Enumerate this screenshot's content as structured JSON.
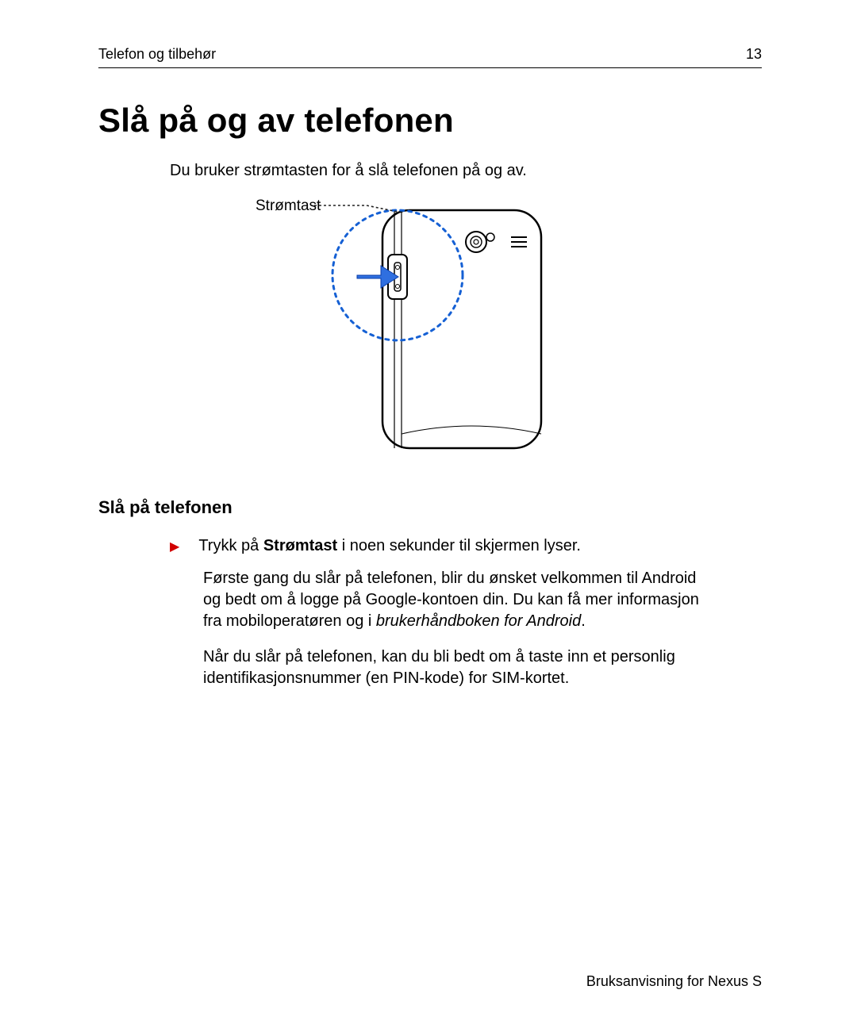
{
  "header": {
    "section": "Telefon og tilbehør",
    "page_number": "13"
  },
  "title": "Slå på og av telefonen",
  "intro": "Du bruker strømtasten for å slå telefonen på og av.",
  "figure": {
    "callout_label": "Strømtast"
  },
  "subheading": "Slå på telefonen",
  "bullet": {
    "pre": "Trykk på ",
    "bold": "Strømtast",
    "post": " i noen sekunder til skjermen lyser."
  },
  "para1": {
    "pre": "Første gang du slår på telefonen, blir du ønsket velkommen til Android og bedt om å logge på Google-kontoen din. Du kan få mer informasjon fra mobiloperatøren og i ",
    "italic": "brukerhåndboken for Android",
    "post": "."
  },
  "para2": "Når du slår på telefonen, kan du bli bedt om å taste inn et personlig identifikasjonsnummer (en PIN-kode) for SIM-kortet.",
  "footer": "Bruksanvisning for Nexus S"
}
